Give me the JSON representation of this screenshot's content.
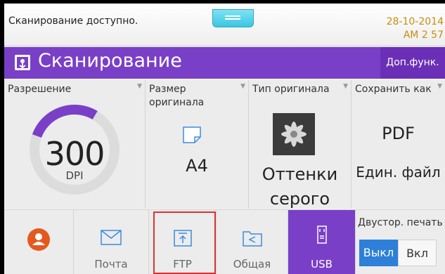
{
  "status": {
    "message": "Сканирование доступно.",
    "date": "28-10-2014",
    "time": "AM 2  57"
  },
  "title": {
    "text": "Сканирование",
    "more_label": "Доп.функ.",
    "icon": "scan-app-icon"
  },
  "settings": {
    "resolution": {
      "label": "Разрешение",
      "value": "300",
      "unit": "DPI",
      "ring_level": 0.28
    },
    "original_size": {
      "label_line1": "Размер",
      "label_line2": "оригинала",
      "value": "A4",
      "icon": "paper-icon"
    },
    "original_type": {
      "label": "Тип оригинала",
      "value_line1": "Оттенки",
      "value_line2": "серого",
      "icon": "grayscale-photo-icon"
    },
    "save_as": {
      "label": "Сохранить как",
      "format": "PDF",
      "mode": "Един. файл"
    }
  },
  "destinations": [
    {
      "label": "",
      "icon": "address-book-icon"
    },
    {
      "label": "Почта",
      "icon": "mail-icon"
    },
    {
      "label": "FTP",
      "icon": "ftp-upload-icon"
    },
    {
      "label": "Общая",
      "icon": "shared-folder-icon"
    },
    {
      "label": "USB",
      "icon": "usb-icon"
    }
  ],
  "duplex": {
    "label": "Двустор. печать",
    "off_label": "Выкл",
    "on_label": "Вкл",
    "selected": "off"
  },
  "colors": {
    "accent": "#7a3fc7",
    "toggle_active": "#2d7fd8",
    "date": "#c58f10",
    "highlight": "#e03030"
  }
}
